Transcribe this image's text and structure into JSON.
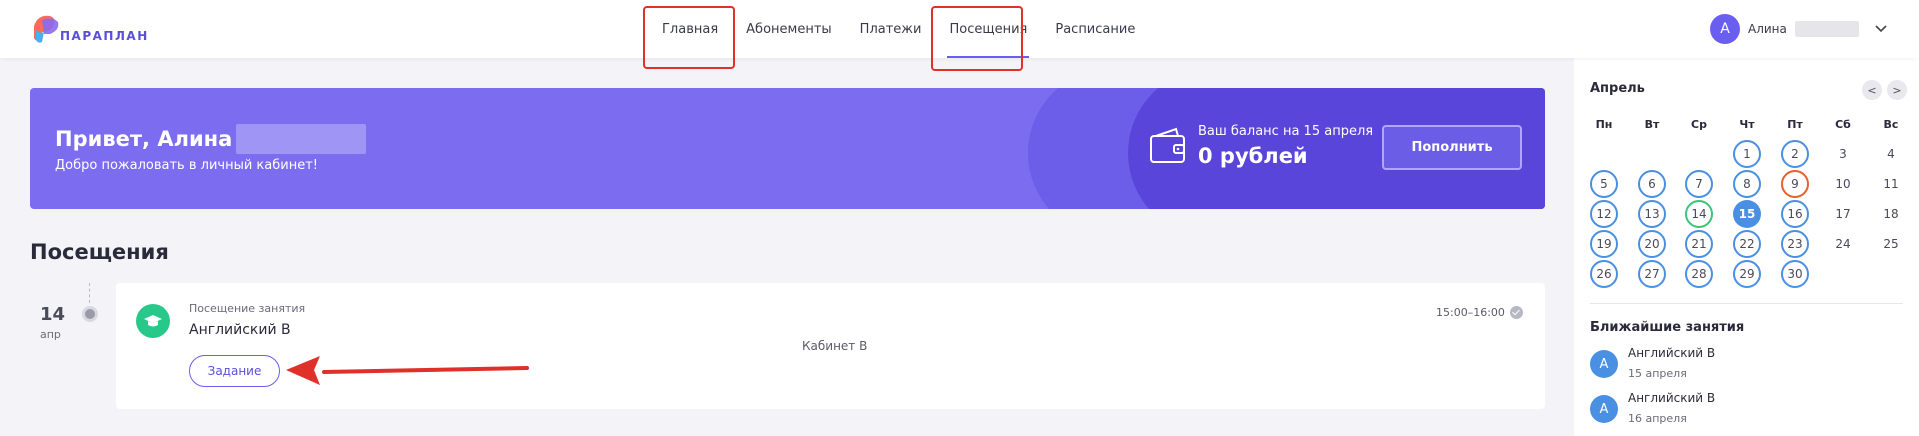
{
  "header": {
    "logo_text": "ПАРАПЛАН",
    "nav": [
      "Главная",
      "Абонементы",
      "Платежи",
      "Посещения",
      "Расписание"
    ],
    "active_nav": "Посещения",
    "user": {
      "initial": "А",
      "name": "Алина"
    }
  },
  "banner": {
    "greeting": "Привет, Алина",
    "subtitle": "Добро пожаловать в личный кабинет!",
    "balance_label": "Ваш баланс на 15 апреля",
    "balance_value": "0 рублей",
    "topup_label": "Пополнить"
  },
  "visits": {
    "title": "Посещения",
    "items": [
      {
        "day": "14",
        "month": "апр",
        "type": "Посещение занятия",
        "subject": "Английский В",
        "room": "Кабинет В",
        "time": "15:00–16:00",
        "task_label": "Задание"
      }
    ]
  },
  "calendar": {
    "month": "Апрель",
    "prev_label": "<",
    "next_label": ">",
    "weekdays": [
      "Пн",
      "Вт",
      "Ср",
      "Чт",
      "Пт",
      "Сб",
      "Вс"
    ],
    "days": [
      "1",
      "2",
      "3",
      "4",
      "5",
      "6",
      "7",
      "8",
      "9",
      "10",
      "11",
      "12",
      "13",
      "14",
      "15",
      "16",
      "17",
      "18",
      "19",
      "20",
      "21",
      "22",
      "23",
      "24",
      "25",
      "26",
      "27",
      "28",
      "29",
      "30"
    ],
    "today": "15"
  },
  "upcoming": {
    "title": "Ближайшие занятия",
    "items": [
      {
        "initial": "А",
        "name": "Английский В",
        "date": "15 апреля"
      },
      {
        "initial": "А",
        "name": "Английский В",
        "date": "16 апреля"
      }
    ]
  },
  "colors": {
    "accent": "#6a5ef0",
    "banner": "#7b6cf0",
    "highlight": "#e0302a",
    "calendar_marked": "#4a90e2",
    "calendar_green": "#3cc47c",
    "calendar_orange": "#e8602a",
    "success": "#27c88a"
  },
  "icons": [
    "logo-icon",
    "chevron-down-icon",
    "wallet-icon",
    "graduation-cap-icon",
    "check-circle-icon",
    "arrow-left-annotation-icon"
  ]
}
